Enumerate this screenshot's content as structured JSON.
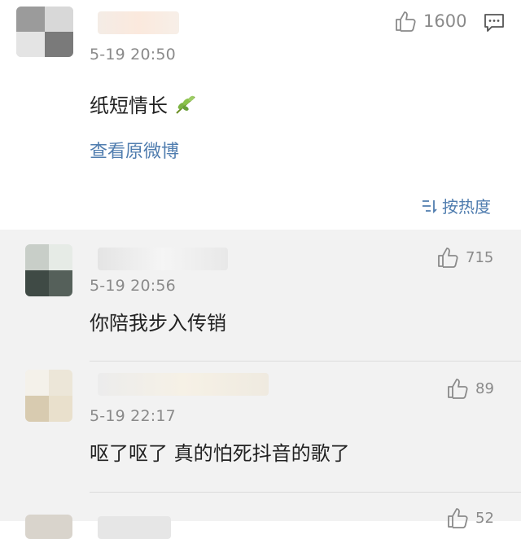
{
  "main_comment": {
    "timestamp": "5-19 20:50",
    "text": "纸短情长",
    "leaf_emoji": "leaf-emoji",
    "like_count": "1600",
    "view_original": "查看原微博"
  },
  "sort_label": "按热度",
  "replies": [
    {
      "timestamp": "5-19 20:56",
      "text": "你陪我步入传销",
      "like_count": "715"
    },
    {
      "timestamp": "5-19 22:17",
      "text": "呕了呕了  真的怕死抖音的歌了",
      "like_count": "89"
    },
    {
      "like_count": "52"
    }
  ],
  "colors": {
    "link": "#507daf",
    "reply_bg": "#f2f2f2",
    "muted": "#8a8a8a"
  }
}
